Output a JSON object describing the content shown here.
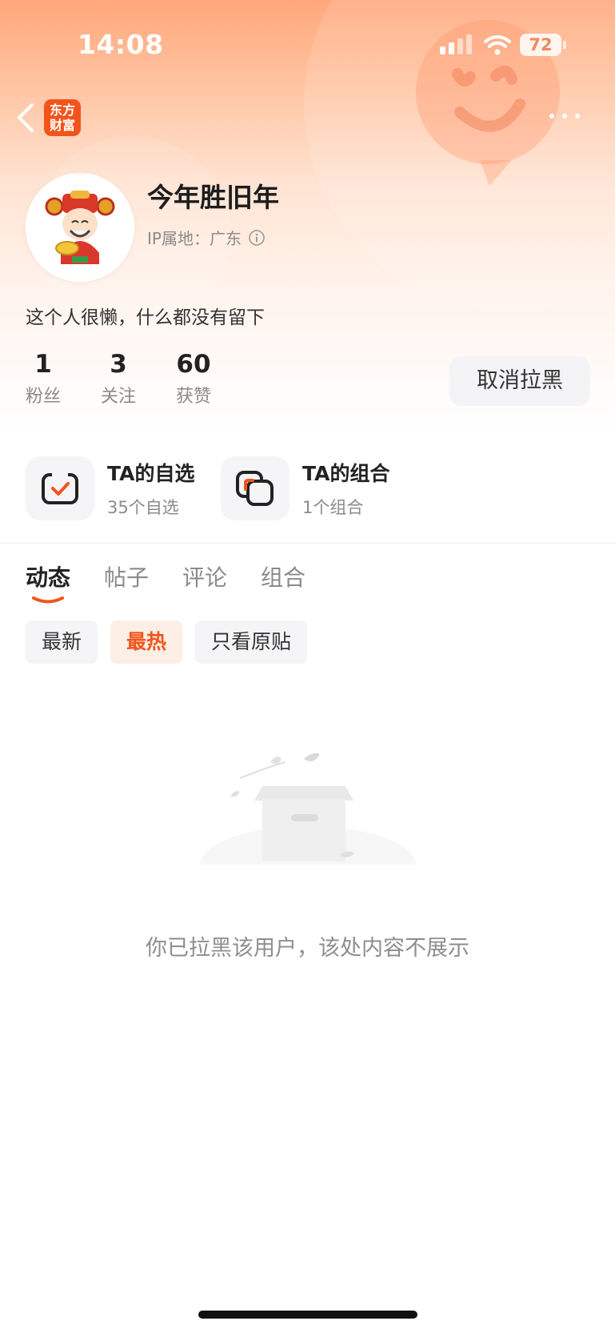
{
  "status_bar": {
    "time": "14:08",
    "battery": "72"
  },
  "nav": {
    "app_logo_line1": "东方",
    "app_logo_line2": "财富"
  },
  "profile": {
    "name": "今年胜旧年",
    "ip_label": "IP属地：广东",
    "bio": "这个人很懒，什么都没有留下",
    "stats": [
      {
        "value": "1",
        "label": "粉丝"
      },
      {
        "value": "3",
        "label": "关注"
      },
      {
        "value": "60",
        "label": "获赞"
      }
    ],
    "unblock_button": "取消拉黑"
  },
  "features": [
    {
      "title": "TA的自选",
      "subtitle": "35个自选",
      "icon": "checklist-icon"
    },
    {
      "title": "TA的组合",
      "subtitle": "1个组合",
      "icon": "portfolio-icon"
    }
  ],
  "tabs": [
    "动态",
    "帖子",
    "评论",
    "组合"
  ],
  "active_tab": "动态",
  "filters": [
    "最新",
    "最热",
    "只看原贴"
  ],
  "active_filter": "最热",
  "empty_state": {
    "message": "你已拉黑该用户，该处内容不展示"
  },
  "colors": {
    "accent": "#f2541b",
    "hero_top": "#ffa77a"
  }
}
